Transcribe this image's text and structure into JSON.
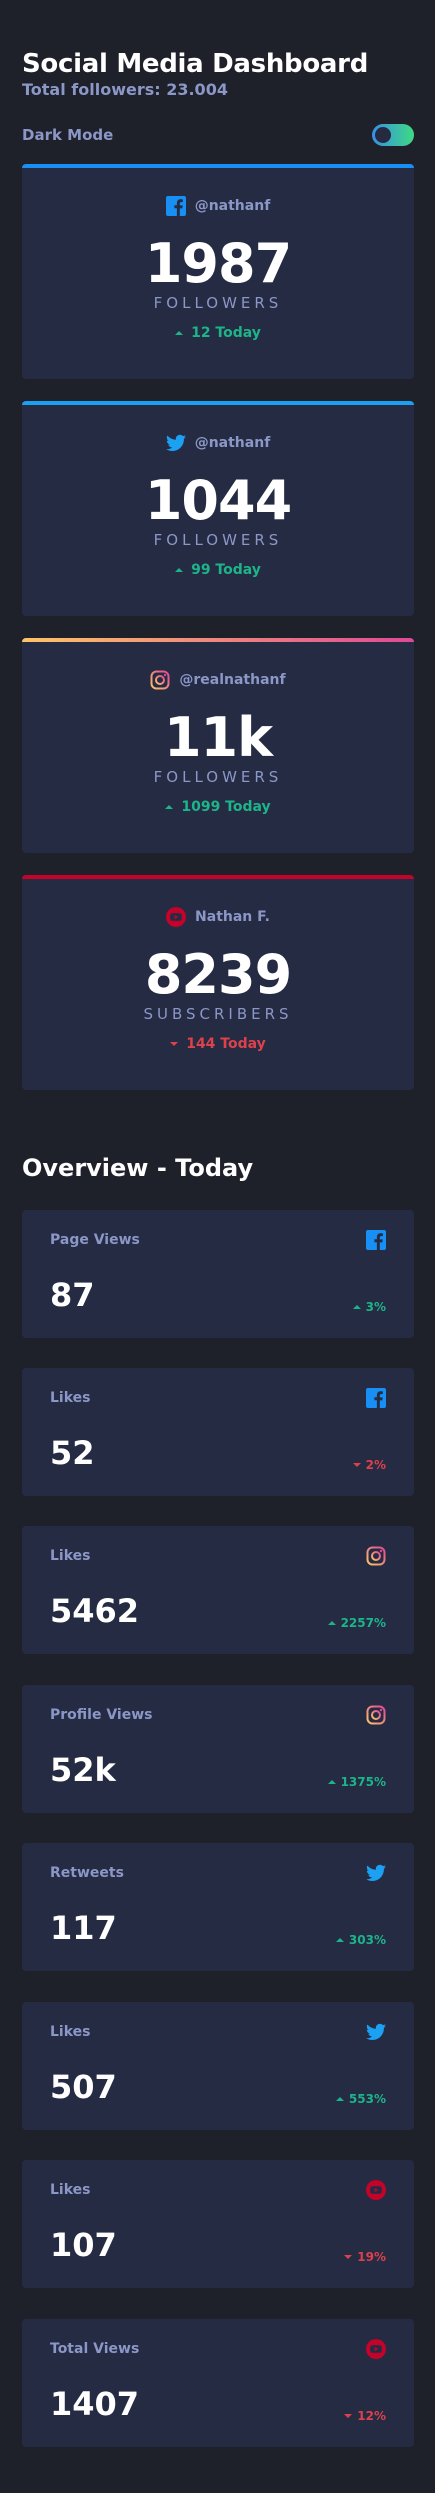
{
  "header": {
    "title": "Social Media Dashboard",
    "total_followers": "Total followers: 23.004"
  },
  "theme_toggle": {
    "label": "Dark Mode",
    "checked": true
  },
  "colors": {
    "facebook": "#178ff5",
    "twitter": "#1ca0f2",
    "instagram_start": "#fdc468",
    "instagram_end": "#df4996",
    "youtube": "#c4032a",
    "up": "#1db489",
    "down": "#dc414c"
  },
  "cards": [
    {
      "platform": "facebook",
      "icon": "facebook-icon",
      "handle": "@nathanf",
      "count": "1987",
      "unit": "FOLLOWERS",
      "today": "12 Today",
      "trend": "up"
    },
    {
      "platform": "twitter",
      "icon": "twitter-icon",
      "handle": "@nathanf",
      "count": "1044",
      "unit": "FOLLOWERS",
      "today": "99 Today",
      "trend": "up"
    },
    {
      "platform": "instagram",
      "icon": "instagram-icon",
      "handle": "@realnathanf",
      "count": "11k",
      "unit": "FOLLOWERS",
      "today": "1099 Today",
      "trend": "up"
    },
    {
      "platform": "youtube",
      "icon": "youtube-icon",
      "handle": "Nathan F.",
      "count": "8239",
      "unit": "SUBSCRIBERS",
      "today": "144 Today",
      "trend": "down"
    }
  ],
  "overview": {
    "title": "Overview - Today",
    "items": [
      {
        "label": "Page Views",
        "icon": "facebook-icon",
        "value": "87",
        "change": "3%",
        "trend": "up"
      },
      {
        "label": "Likes",
        "icon": "facebook-icon",
        "value": "52",
        "change": "2%",
        "trend": "down"
      },
      {
        "label": "Likes",
        "icon": "instagram-icon",
        "value": "5462",
        "change": "2257%",
        "trend": "up"
      },
      {
        "label": "Profile Views",
        "icon": "instagram-icon",
        "value": "52k",
        "change": "1375%",
        "trend": "up"
      },
      {
        "label": "Retweets",
        "icon": "twitter-icon",
        "value": "117",
        "change": "303%",
        "trend": "up"
      },
      {
        "label": "Likes",
        "icon": "twitter-icon",
        "value": "507",
        "change": "553%",
        "trend": "up"
      },
      {
        "label": "Likes",
        "icon": "youtube-icon",
        "value": "107",
        "change": "19%",
        "trend": "down"
      },
      {
        "label": "Total Views",
        "icon": "youtube-icon",
        "value": "1407",
        "change": "12%",
        "trend": "down"
      }
    ]
  }
}
